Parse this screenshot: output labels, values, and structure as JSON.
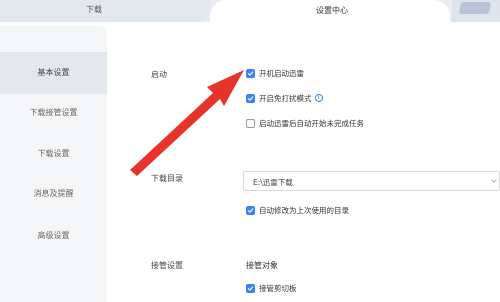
{
  "tabs": {
    "download": "下载",
    "settings": "设置中心"
  },
  "sidebar": {
    "items": [
      {
        "label": "基本设置"
      },
      {
        "label": "下载接管设置"
      },
      {
        "label": "下载设置"
      },
      {
        "label": "消息及提醒"
      },
      {
        "label": "高级设置"
      }
    ]
  },
  "startup": {
    "label": "启动",
    "options": [
      {
        "label": "开机启动迅雷",
        "checked": true
      },
      {
        "label": "开启免打扰模式",
        "checked": true
      },
      {
        "label": "启动迅雷后自动开始未完成任务",
        "checked": false
      }
    ]
  },
  "download_dir": {
    "label": "下载目录",
    "value": "E:\\迅雷下载",
    "auto_change_label": "自动修改为上次使用的目录",
    "auto_change_checked": true
  },
  "takeover": {
    "label": "接管设置",
    "target_label": "接管对象",
    "clipboard_label": "接管剪切板",
    "clipboard_checked": true
  },
  "colors": {
    "accent": "#3b82f6",
    "annotation_arrow": "#e8332a"
  },
  "icons": [
    "check-icon",
    "info-icon",
    "chevron-down-icon",
    "annotation-arrow"
  ]
}
